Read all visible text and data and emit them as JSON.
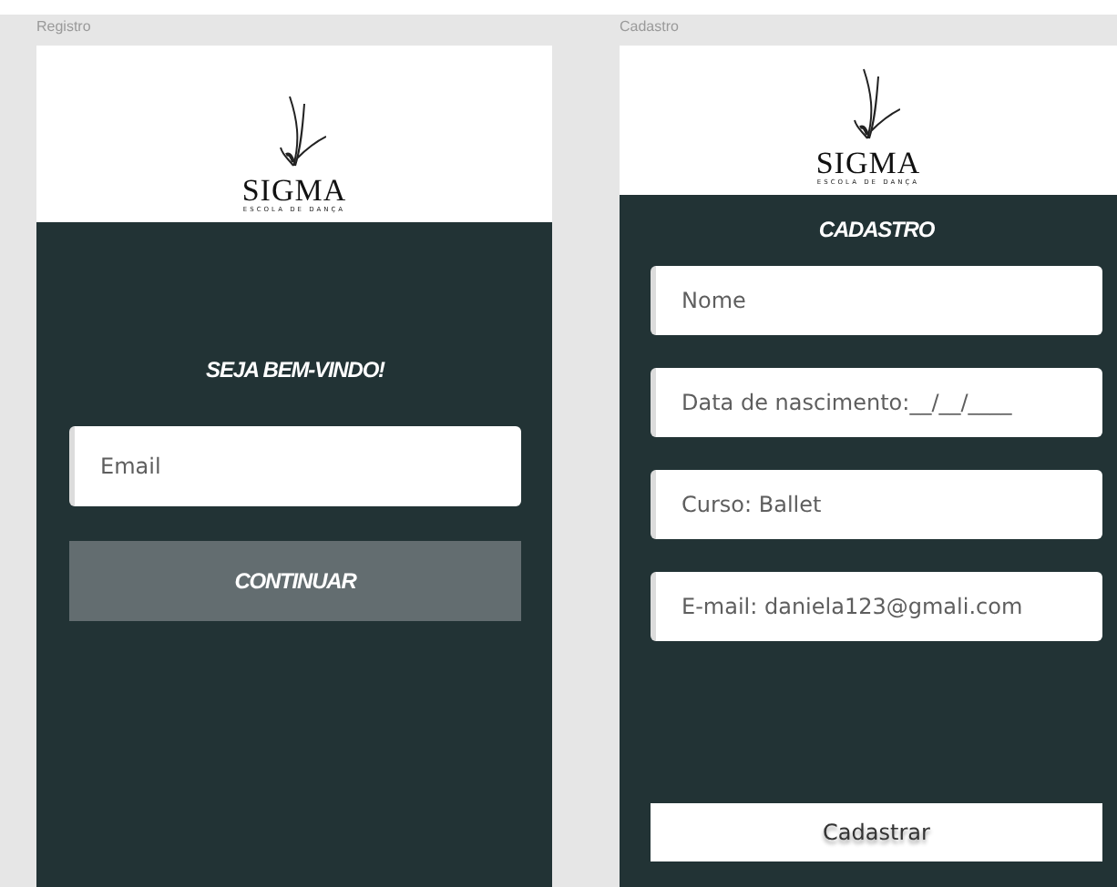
{
  "artboards": [
    {
      "label": "Registro",
      "logo": {
        "name": "SIGMA",
        "tagline": "ESCOLA DE DANÇA"
      },
      "title": "SEJA BEM-VINDO!",
      "fields": [
        {
          "placeholder": "Email"
        }
      ],
      "button": {
        "label": "CONTINUAR",
        "kind": "muted"
      }
    },
    {
      "label": "Cadastro",
      "logo": {
        "name": "SIGMA",
        "tagline": "ESCOLA DE DANÇA"
      },
      "title": "CADASTRO",
      "fields": [
        {
          "placeholder": "Nome"
        },
        {
          "placeholder": "Data de nascimento:__/__/____"
        },
        {
          "placeholder": "Curso: Ballet"
        },
        {
          "placeholder": "E-mail: daniela123@gmali.com"
        }
      ],
      "button": {
        "label": "Cadastrar",
        "kind": "light"
      }
    }
  ]
}
